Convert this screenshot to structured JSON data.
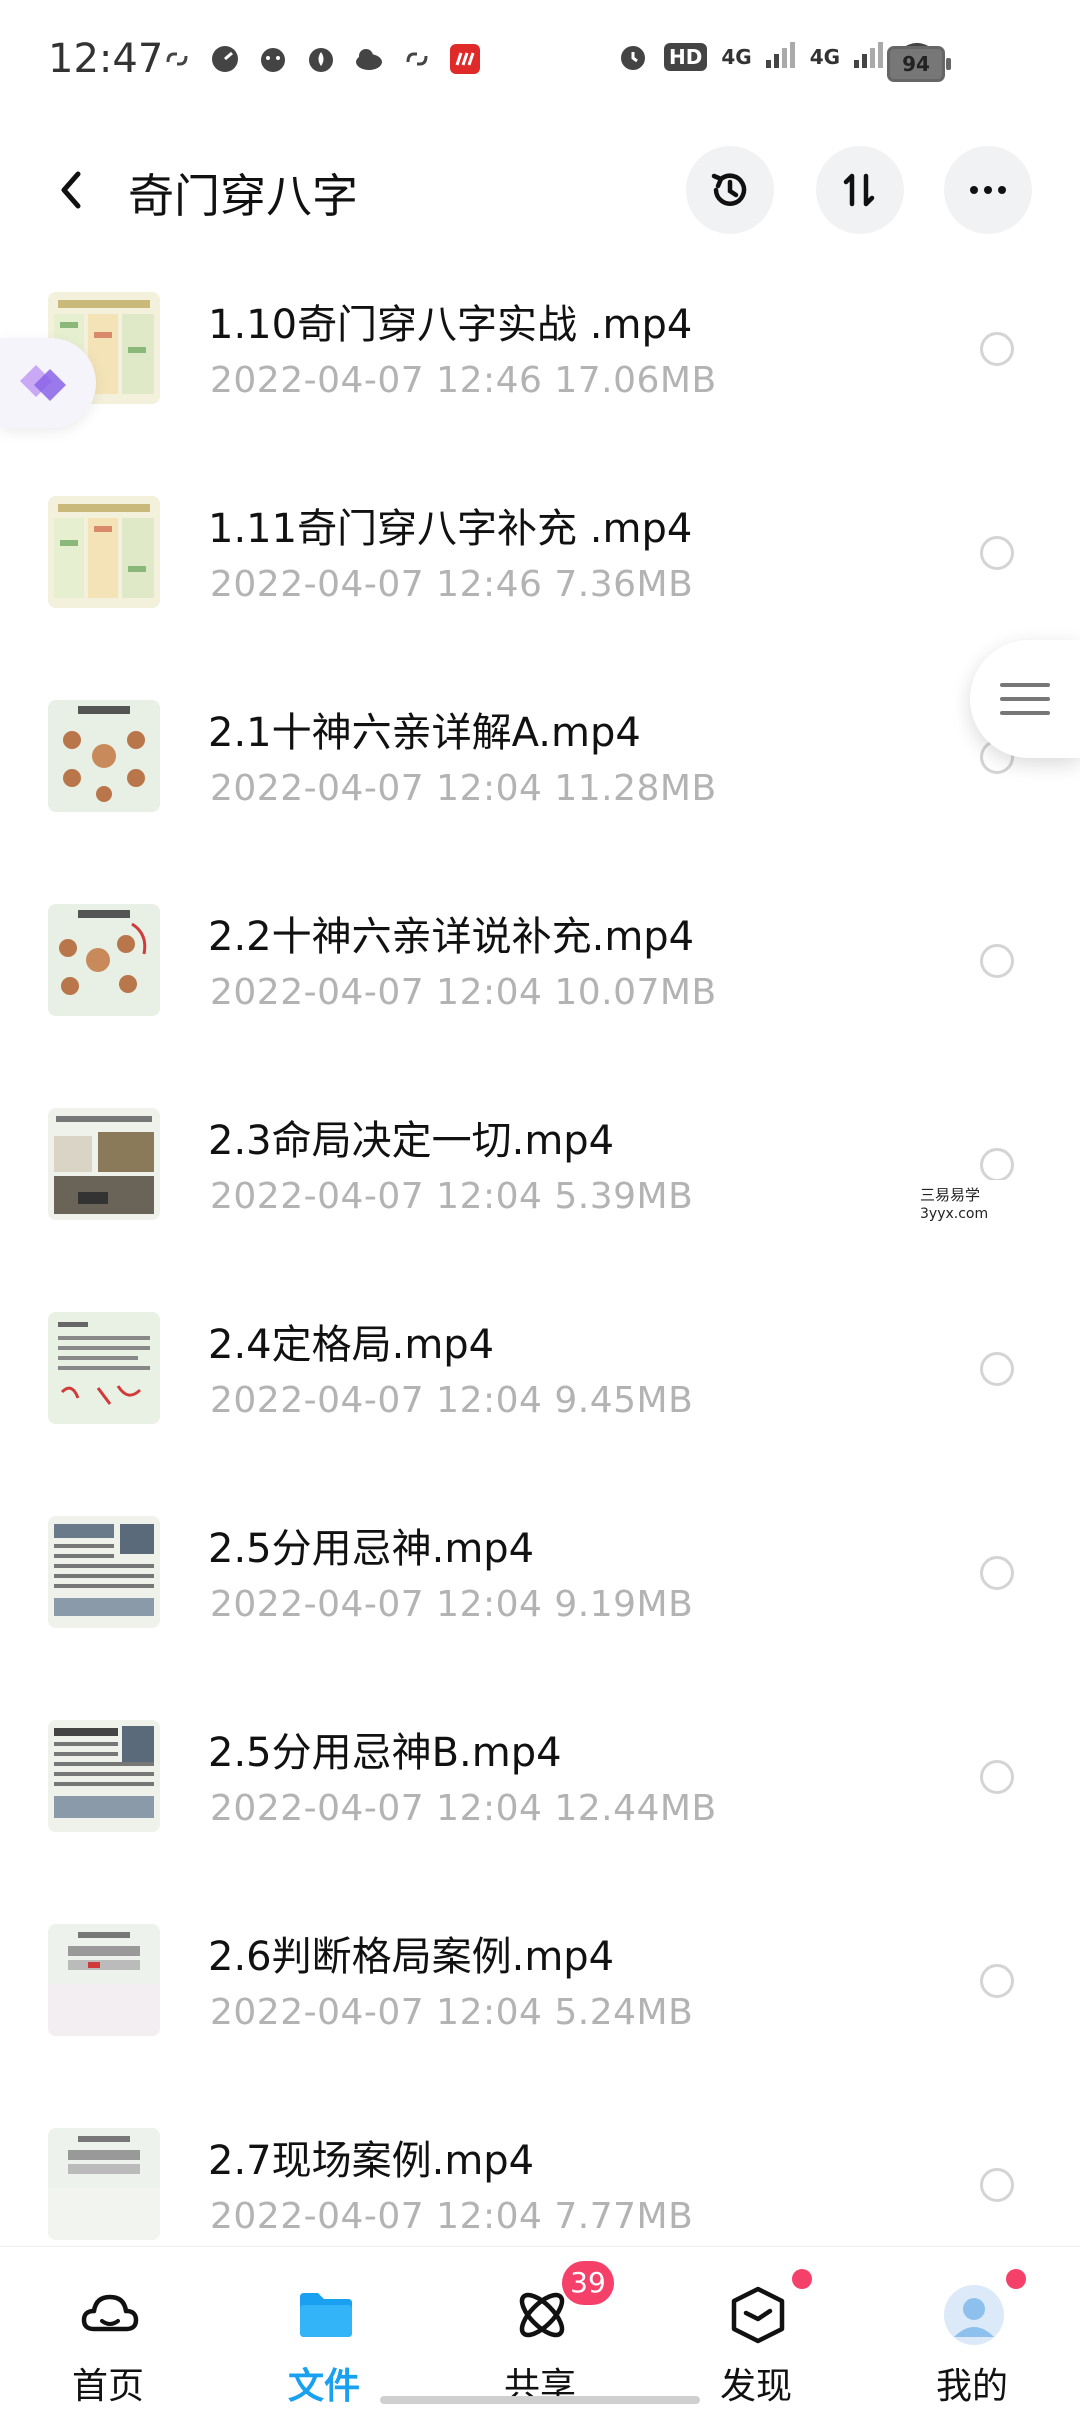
{
  "status_bar": {
    "time": "12:47",
    "network_1": "4G",
    "network_2": "4G",
    "hd_label": "HD",
    "battery": "94"
  },
  "header": {
    "title": "奇门穿八字"
  },
  "files": [
    {
      "name": "1.10奇门穿八字实战 .mp4",
      "date": "2022-04-07",
      "time": "12:46",
      "size": "17.06MB",
      "thumb": "table"
    },
    {
      "name": "1.11奇门穿八字补充 .mp4",
      "date": "2022-04-07",
      "time": "12:46",
      "size": "7.36MB",
      "thumb": "table"
    },
    {
      "name": "2.1十神六亲详解A.mp4",
      "date": "2022-04-07",
      "time": "12:04",
      "size": "11.28MB",
      "thumb": "diagram"
    },
    {
      "name": "2.2十神六亲详说补充.mp4",
      "date": "2022-04-07",
      "time": "12:04",
      "size": "10.07MB",
      "thumb": "diagram"
    },
    {
      "name": "2.3命局决定一切.mp4",
      "date": "2022-04-07",
      "time": "12:04",
      "size": "5.39MB",
      "thumb": "photo"
    },
    {
      "name": "2.4定格局.mp4",
      "date": "2022-04-07",
      "time": "12:04",
      "size": "9.45MB",
      "thumb": "text"
    },
    {
      "name": "2.5分用忌神.mp4",
      "date": "2022-04-07",
      "time": "12:04",
      "size": "9.19MB",
      "thumb": "dense"
    },
    {
      "name": "2.5分用忌神B.mp4",
      "date": "2022-04-07",
      "time": "12:04",
      "size": "12.44MB",
      "thumb": "dense"
    },
    {
      "name": "2.6判断格局案例.mp4",
      "date": "2022-04-07",
      "time": "12:04",
      "size": "5.24MB",
      "thumb": "chart"
    },
    {
      "name": "2.7现场案例.mp4",
      "date": "2022-04-07",
      "time": "12:04",
      "size": "7.77MB",
      "thumb": "chart"
    }
  ],
  "watermark": {
    "line1": "三易易学",
    "line2": "3yyx.com"
  },
  "bottom_nav": {
    "items": [
      {
        "label": "首页",
        "icon": "cloud-icon"
      },
      {
        "label": "文件",
        "icon": "folder-icon"
      },
      {
        "label": "共享",
        "icon": "atom-icon"
      },
      {
        "label": "发现",
        "icon": "cube-icon"
      },
      {
        "label": "我的",
        "icon": "avatar-icon"
      }
    ],
    "share_badge": "39"
  },
  "colors": {
    "accent": "#1aa0f0",
    "badge": "#f5416a",
    "meta_text": "#b3b3b3"
  }
}
